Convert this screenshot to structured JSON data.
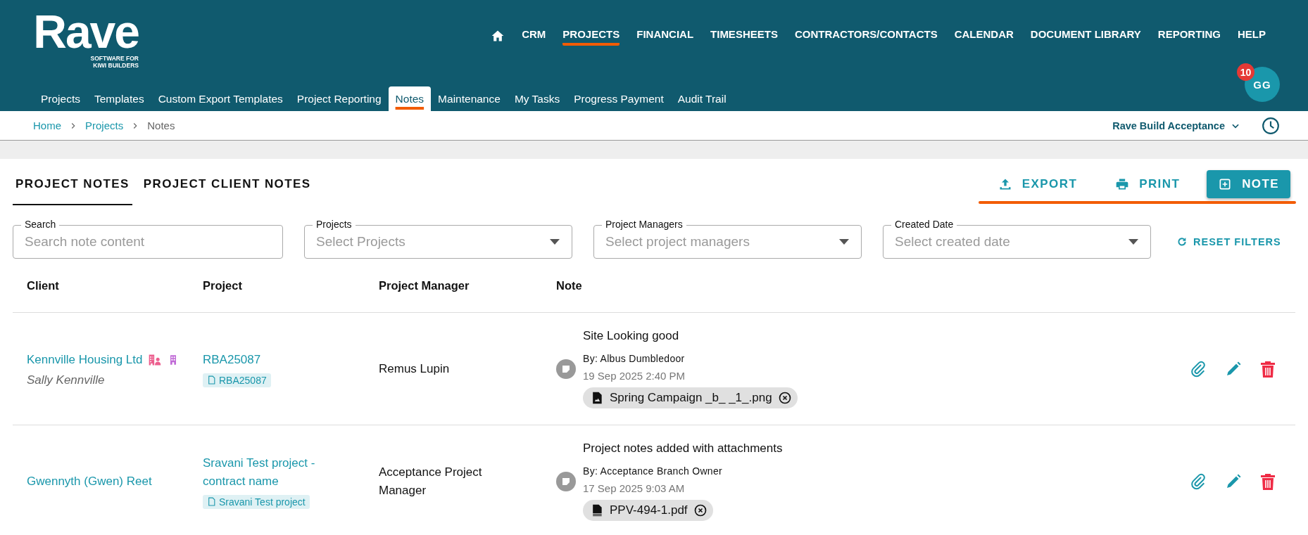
{
  "header": {
    "logo": {
      "name": "Rave",
      "tagline": [
        "SOFTWARE FOR",
        "KIWI BUILDERS"
      ]
    },
    "top_nav": [
      {
        "label": "CRM",
        "selected": false
      },
      {
        "label": "PROJECTS",
        "selected": true
      },
      {
        "label": "FINANCIAL",
        "selected": false
      },
      {
        "label": "TIMESHEETS",
        "selected": false
      },
      {
        "label": "CONTRACTORS/CONTACTS",
        "selected": false
      },
      {
        "label": "CALENDAR",
        "selected": false
      },
      {
        "label": "DOCUMENT LIBRARY",
        "selected": false
      },
      {
        "label": "REPORTING",
        "selected": false
      },
      {
        "label": "HELP",
        "selected": false
      }
    ],
    "sub_nav": [
      {
        "label": "Projects",
        "selected": false
      },
      {
        "label": "Templates",
        "selected": false
      },
      {
        "label": "Custom Export Templates",
        "selected": false
      },
      {
        "label": "Project Reporting",
        "selected": false
      },
      {
        "label": "Notes",
        "selected": true
      },
      {
        "label": "Maintenance",
        "selected": false
      },
      {
        "label": "My Tasks",
        "selected": false
      },
      {
        "label": "Progress Payment",
        "selected": false
      },
      {
        "label": "Audit Trail",
        "selected": false
      }
    ],
    "avatar": {
      "initials": "GG",
      "badge": "10"
    }
  },
  "breadcrumb": [
    "Home",
    "Projects",
    "Notes"
  ],
  "company_selector": "Rave Build Acceptance",
  "tabs": [
    {
      "label": "PROJECT NOTES",
      "selected": true
    },
    {
      "label": "PROJECT CLIENT NOTES",
      "selected": false
    }
  ],
  "actions": [
    {
      "label": "EXPORT",
      "kind": "export"
    },
    {
      "label": "PRINT",
      "kind": "print"
    },
    {
      "label": "NOTE",
      "kind": "add"
    }
  ],
  "filters": [
    {
      "label": "Search",
      "placeholder": "Search note content",
      "kind": "text"
    },
    {
      "label": "Projects",
      "placeholder": "Select Projects",
      "kind": "select"
    },
    {
      "label": "Project Managers",
      "placeholder": "Select project managers",
      "kind": "select"
    },
    {
      "label": "Created Date",
      "placeholder": "Select created date",
      "kind": "select"
    }
  ],
  "reset_filters": "RESET FILTERS",
  "table": {
    "columns": [
      "Client",
      "Project",
      "Project Manager",
      "Note"
    ],
    "rows": [
      {
        "client": "Kennville Housing Ltd",
        "client_icons": [
          {
            "kind": "business-contact"
          },
          {
            "kind": "building"
          }
        ],
        "contact": "Sally Kennville",
        "project": "RBA25087",
        "project_tag": "RBA25087",
        "manager": "Remus Lupin",
        "note_title": "Site Looking good",
        "author": "By: Albus Dumbledoor",
        "date": "19 Sep 2025 2:40 PM",
        "attachment": {
          "name": "Spring Campaign _b_ _1_.png",
          "kind": "image"
        }
      },
      {
        "client": "Gwennyth (Gwen) Reet",
        "project": "Sravani Test project - contract name",
        "project_tag": "Sravani Test project",
        "manager": "Acceptance Project Manager",
        "note_title": "Project notes added with attachments",
        "author": "By: Acceptance Branch Owner",
        "date": "17 Sep 2025 9:03 AM",
        "attachment": {
          "name": "PPV-494-1.pdf",
          "kind": "pdf"
        }
      }
    ]
  }
}
